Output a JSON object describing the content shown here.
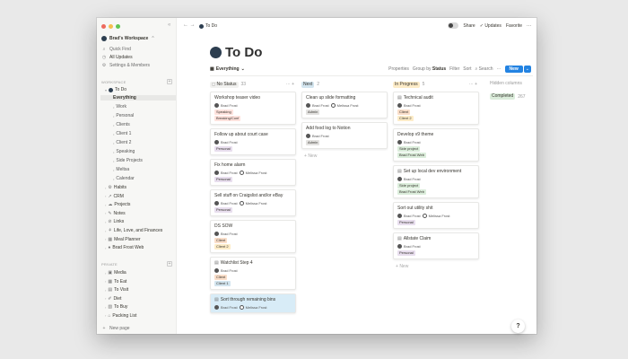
{
  "sidebar": {
    "workspace": "Brad's Workspace",
    "workspace_chevron": "⌃",
    "quick_find": "Quick Find",
    "all_updates": "All Updates",
    "settings": "Settings & Members",
    "workspace_label": "WORKSPACE",
    "private_label": "PRIVATE",
    "todo": "To Do",
    "todo_children": [
      "Everything",
      "Work",
      "Personal",
      "Clients",
      "Client 1",
      "Client 2",
      "Speaking",
      "Side Projects",
      "Meltsa",
      "Calendar"
    ],
    "workspace_items": [
      {
        "icon": "⚙",
        "label": "Habits"
      },
      {
        "icon": "↗",
        "label": "CRM"
      },
      {
        "icon": "☁",
        "label": "Projects"
      },
      {
        "icon": "✎",
        "label": "Notes"
      },
      {
        "icon": "⊘",
        "label": "Links"
      },
      {
        "icon": "⚘",
        "label": "Life, Love, and Finances"
      },
      {
        "icon": "▦",
        "label": "Meal Planner"
      },
      {
        "icon": "●",
        "label": "Brad Frost Web"
      }
    ],
    "private_items": [
      {
        "icon": "▣",
        "label": "Media"
      },
      {
        "icon": "▦",
        "label": "To Eat"
      },
      {
        "icon": "▤",
        "label": "To Visit"
      },
      {
        "icon": "✐",
        "label": "Diet"
      },
      {
        "icon": "▧",
        "label": "To Buy"
      },
      {
        "icon": "⌂",
        "label": "Packing List"
      }
    ],
    "new_page": "New page"
  },
  "topbar": {
    "crumb": "To Do",
    "share": "Share",
    "updates": "Updates",
    "favorite": "Favorite",
    "more": "···"
  },
  "page": {
    "title": "To Do",
    "view": "Everything",
    "properties": "Properties",
    "group_by_prefix": "Group by",
    "group_by_value": "Status",
    "filter": "Filter",
    "sort": "Sort",
    "search": "Search",
    "more": "···",
    "new": "New"
  },
  "columns": [
    {
      "name": "No Status",
      "count": "33",
      "color": "#f1f1ef",
      "show_actions": true,
      "cards": [
        {
          "title": "Workshop teaser video",
          "people": [
            "Brad Frost"
          ],
          "tags": [
            {
              "text": "Speaking",
              "bg": "#ffe2dd"
            },
            {
              "text": "Breaking/Conf",
              "bg": "#ffe2dd"
            }
          ]
        },
        {
          "title": "Follow up about court case",
          "people": [
            "Brad Frost"
          ],
          "tags": [
            {
              "text": "Personal",
              "bg": "#e8deee"
            }
          ]
        },
        {
          "title": "Fix home alarm",
          "people": [
            "Brad Frost",
            "Melissa Frost"
          ],
          "tags": [
            {
              "text": "Personal",
              "bg": "#e8deee"
            }
          ]
        },
        {
          "title": "Sell stuff on Craigslist and/or eBay",
          "people": [
            "Brad Frost",
            "Melissa Frost"
          ],
          "tags": [
            {
              "text": "Personal",
              "bg": "#e8deee"
            }
          ]
        },
        {
          "title": "DS SOW",
          "people": [
            "Brad Frost"
          ],
          "tags": [
            {
              "text": "Client",
              "bg": "#fadec9"
            },
            {
              "text": "Client 2",
              "bg": "#fdecc8"
            }
          ]
        },
        {
          "title": "Watchlist Step 4",
          "doc": true,
          "people": [
            "Brad Frost"
          ],
          "tags": [
            {
              "text": "Client",
              "bg": "#fadec9"
            },
            {
              "text": "Client 1",
              "bg": "#d3e5ef"
            }
          ]
        },
        {
          "title": "Sort through remaining bins",
          "doc": true,
          "highlight": true,
          "people": [
            "Brad Frost",
            "Melissa Frost"
          ],
          "tags": []
        }
      ],
      "new_label": ""
    },
    {
      "name": "Next",
      "count": "2",
      "color": "#d3e5ef",
      "show_actions": false,
      "cards": [
        {
          "title": "Clean up slide formatting",
          "people": [
            "Brad Frost",
            "Melissa Frost"
          ],
          "tags": [
            {
              "text": "Admin",
              "bg": "#e3e2e0"
            }
          ]
        },
        {
          "title": "Add food log to Notion",
          "people": [
            "Brad Frost"
          ],
          "tags": [
            {
              "text": "Admin",
              "bg": "#e3e2e0"
            }
          ]
        }
      ],
      "new_label": "New"
    },
    {
      "name": "In Progress",
      "count": "5",
      "color": "#fdecc8",
      "show_actions": true,
      "cards": [
        {
          "title": "Technical audit",
          "doc": true,
          "people": [
            "Brad Frost"
          ],
          "tags": [
            {
              "text": "Client",
              "bg": "#fadec9"
            },
            {
              "text": "Client 2",
              "bg": "#fdecc8"
            }
          ]
        },
        {
          "title": "Develop v9 theme",
          "people": [
            "Brad Frost"
          ],
          "tags": [
            {
              "text": "Side project",
              "bg": "#dbeddb"
            },
            {
              "text": "Brad Frost Web",
              "bg": "#dbeddb"
            }
          ]
        },
        {
          "title": "Set up local dev environment",
          "doc": true,
          "people": [
            "Brad Frost"
          ],
          "tags": [
            {
              "text": "Side project",
              "bg": "#dbeddb"
            },
            {
              "text": "Brad Frost Web",
              "bg": "#dbeddb"
            }
          ]
        },
        {
          "title": "Sort out utility shit",
          "people": [
            "Brad Frost",
            "Melissa Frost"
          ],
          "tags": [
            {
              "text": "Personal",
              "bg": "#e8deee"
            }
          ]
        },
        {
          "title": "Allstate Claim",
          "doc": true,
          "people": [
            "Brad Frost"
          ],
          "tags": [
            {
              "text": "Personal",
              "bg": "#e8deee"
            }
          ]
        }
      ],
      "new_label": "New"
    }
  ],
  "hidden_columns": {
    "title": "Hidden columns",
    "items": [
      {
        "name": "Completed",
        "count": "267"
      }
    ]
  },
  "help": "?"
}
